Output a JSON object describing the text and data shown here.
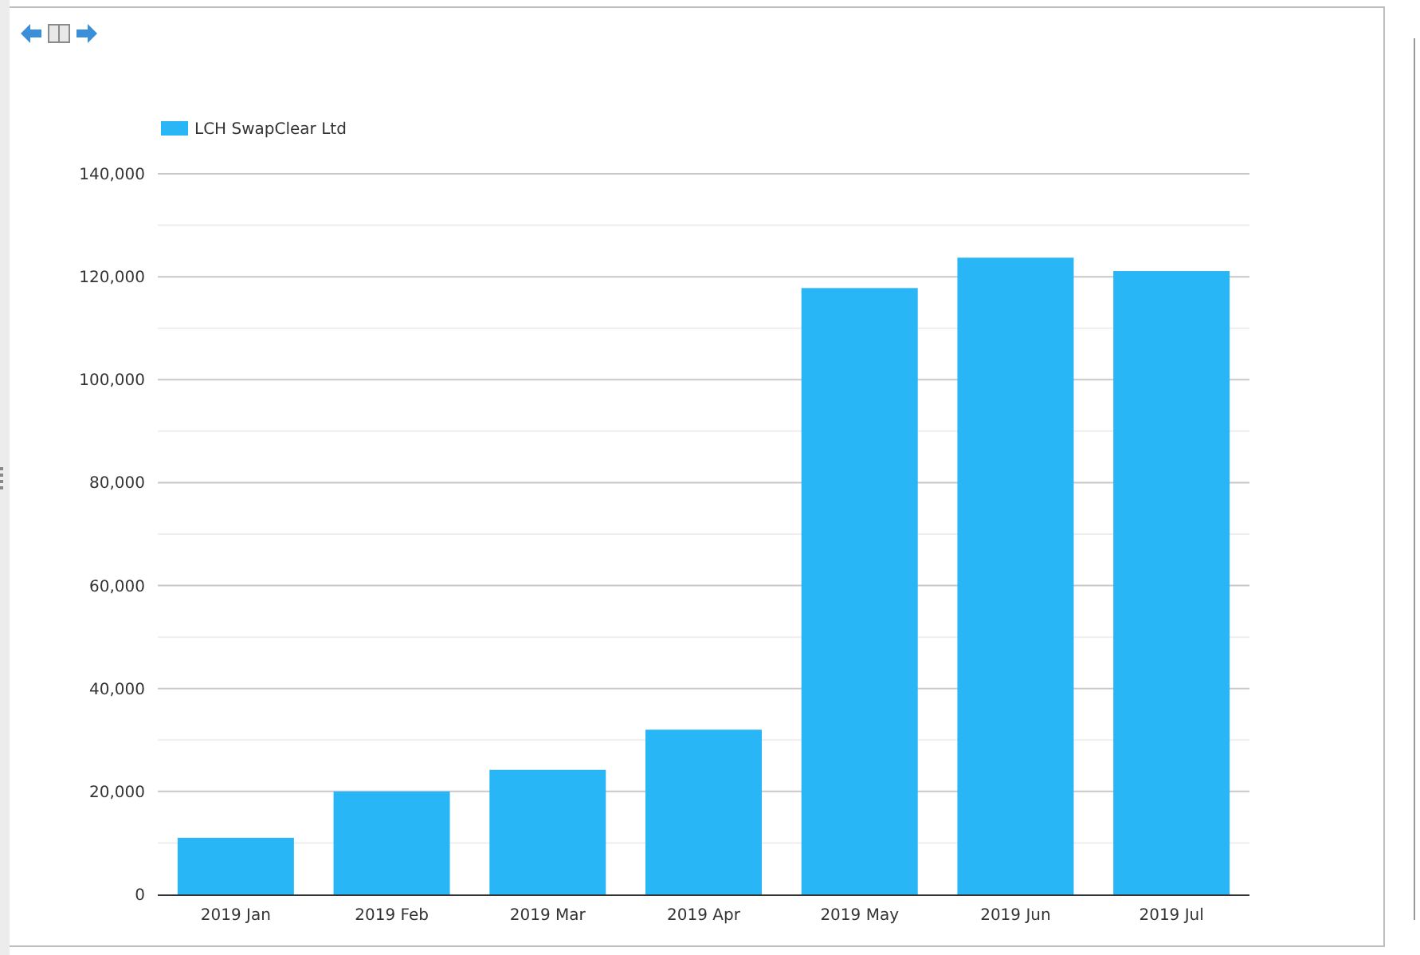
{
  "toolbar": {
    "buttons": [
      {
        "kind": "back"
      },
      {
        "kind": "columns"
      },
      {
        "kind": "forward"
      }
    ]
  },
  "chart": {
    "chart_data": {
      "type": "bar",
      "grid": true,
      "categories": [
        "2019 Jan",
        "2019 Feb",
        "2019 Mar",
        "2019 Apr",
        "2019 May",
        "2019 Jun",
        "2019 Jul"
      ],
      "series": [
        {
          "name": "LCH SwapClear Ltd",
          "color": "#29b6f6",
          "values": [
            11000,
            20000,
            24200,
            32000,
            117800,
            123700,
            121100
          ]
        }
      ],
      "ylim": [
        0,
        140000
      ],
      "yticks": [
        {
          "value": 0,
          "label": "0"
        },
        {
          "value": 20000,
          "label": "20,000"
        },
        {
          "value": 40000,
          "label": "40,000"
        },
        {
          "value": 60000,
          "label": "60,000"
        },
        {
          "value": 80000,
          "label": "80,000"
        },
        {
          "value": 100000,
          "label": "100,000"
        },
        {
          "value": 120000,
          "label": "120,000"
        },
        {
          "value": 140000,
          "label": "140,000"
        }
      ]
    }
  }
}
